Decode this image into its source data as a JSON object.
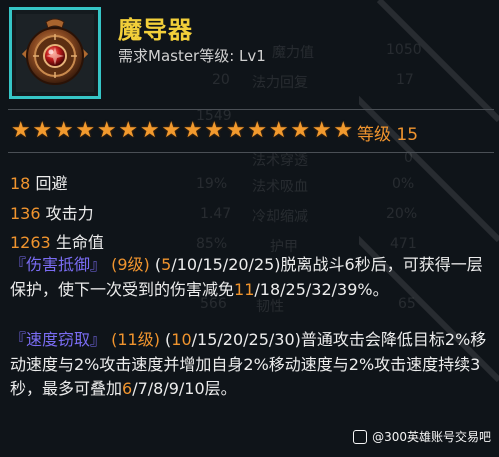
{
  "item": {
    "name": "魔导器",
    "requirement": "需求Master等级: Lv1",
    "icon": "compass-amulet-icon",
    "frame_color": "#36c6c7"
  },
  "stars": {
    "count": 16,
    "filled": 16,
    "color": "#f29a2e",
    "level_label": "等级 15"
  },
  "stats": [
    {
      "value": "18",
      "label": "回避"
    },
    {
      "value": "136",
      "label": "攻击力"
    },
    {
      "value": "1263",
      "label": "生命值"
    }
  ],
  "skills": [
    {
      "name": "『伤害抵御』",
      "level": "(9级)",
      "segments": [
        {
          "t": " (",
          "hl": false
        },
        {
          "t": "5",
          "hl": true
        },
        {
          "t": "/10/15/20/25)脱离战斗6秒后，可获得一层保护，使下一次受到的伤害减免",
          "hl": false
        },
        {
          "t": "11",
          "hl": true
        },
        {
          "t": "/18/25/32/39%。",
          "hl": false
        }
      ]
    },
    {
      "name": "『速度窃取』",
      "level": "(11级)",
      "segments": [
        {
          "t": " (",
          "hl": false
        },
        {
          "t": "10",
          "hl": true
        },
        {
          "t": "/15/20/25/30)普通攻击会降低目标2%移动速度与2%攻击速度并增加自身2%移动速度与2%攻击速度持续3秒，最多可叠加",
          "hl": false
        },
        {
          "t": "6",
          "hl": true
        },
        {
          "t": "/7/8/9/10层。",
          "hl": false
        }
      ]
    }
  ],
  "background_stats": [
    "魔力值",
    "1050",
    "20",
    "法力回复",
    "17",
    "1549",
    "法术穿透",
    "0",
    "19%",
    "法术吸血",
    "0%",
    "1.47",
    "冷却缩减",
    "20%",
    "85%",
    "护甲",
    "471",
    "566",
    "韧性",
    "65"
  ],
  "watermark": "@300英雄账号交易吧"
}
